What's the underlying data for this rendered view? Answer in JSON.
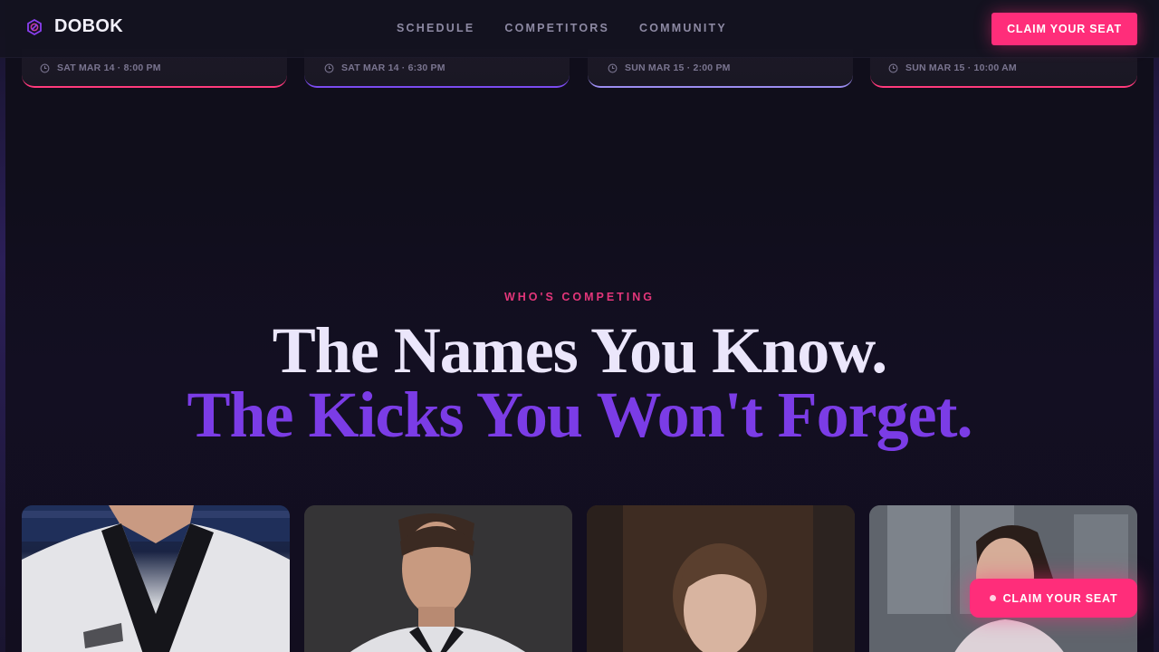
{
  "nav": {
    "brand": "DOBOK",
    "links": [
      "SCHEDULE",
      "COMPETITORS",
      "COMMUNITY"
    ],
    "cta": "CLAIM YOUR SEAT"
  },
  "events": [
    {
      "time": "SAT MAR 14 · 8:00 PM",
      "accent": "#ff3a7c"
    },
    {
      "time": "SAT MAR 14 · 6:30 PM",
      "accent": "#7b4bef"
    },
    {
      "time": "SUN MAR 15 · 2:00 PM",
      "accent": "#9b8cf0"
    },
    {
      "time": "SUN MAR 15 · 10:00 AM",
      "accent": "#ff3a7c"
    }
  ],
  "section": {
    "eyebrow": "WHO'S COMPETING",
    "headline_line1": "The Names You Know.",
    "headline_line2": "The Kicks You Won't Forget."
  },
  "floating_cta": "CLAIM YOUR SEAT",
  "colors": {
    "background": "#100e1b",
    "accent_pink": "#ff2d7a",
    "accent_purple": "#7b3ce6",
    "text": "#ebe6fb"
  }
}
